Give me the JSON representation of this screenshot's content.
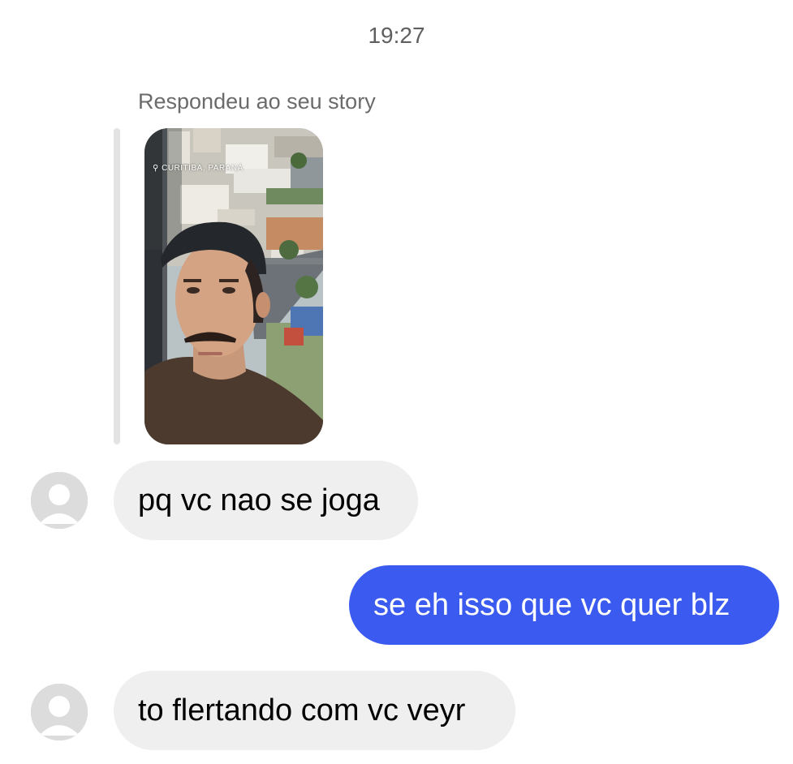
{
  "thread": {
    "timestamp": "19:27",
    "reply_context_label": "Respondeu ao seu story",
    "story": {
      "location_tag": "CURITIBA, PARANÁ"
    }
  },
  "messages": [
    {
      "direction": "incoming",
      "text": "pq vc nao se joga"
    },
    {
      "direction": "outgoing",
      "text": "se eh isso que vc quer blz"
    },
    {
      "direction": "incoming",
      "text": "to flertando com vc veyr"
    }
  ],
  "icons": {
    "avatar": "default-avatar-icon",
    "location_pin": "location-pin-icon"
  },
  "colors": {
    "incoming_bubble": "#efefef",
    "outgoing_bubble": "#3b5bf0",
    "outgoing_text": "#ffffff",
    "secondary_text": "#6b6b6b"
  }
}
